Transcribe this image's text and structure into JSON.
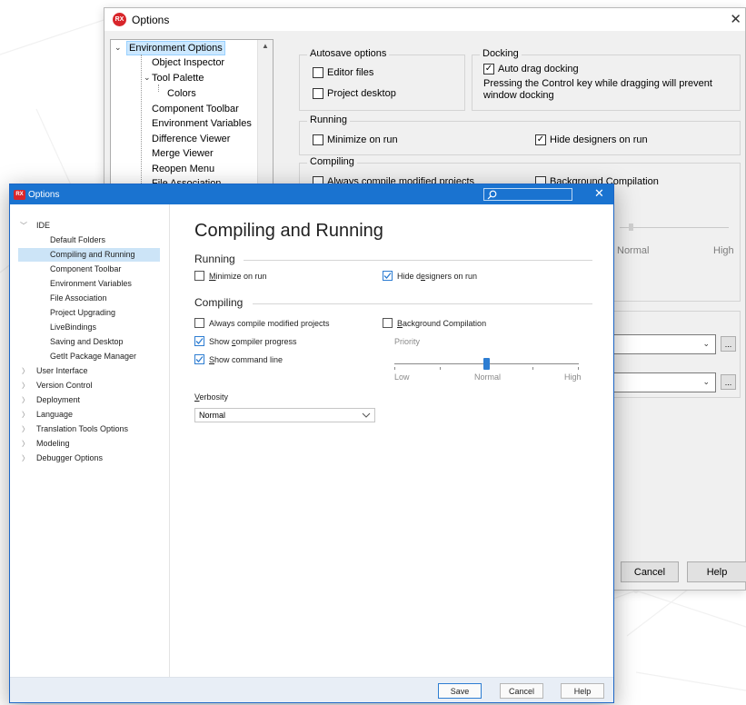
{
  "back_dialog": {
    "title": "Options",
    "close_icon": "close-icon",
    "tree": [
      {
        "label": "Environment Options",
        "expanded": true,
        "selected": true
      },
      {
        "label": "Object Inspector"
      },
      {
        "label": "Tool Palette",
        "expanded": true
      },
      {
        "label": "Colors"
      },
      {
        "label": "Component Toolbar"
      },
      {
        "label": "Environment Variables"
      },
      {
        "label": "Difference Viewer"
      },
      {
        "label": "Merge Viewer"
      },
      {
        "label": "Reopen Menu"
      },
      {
        "label": "File Association"
      }
    ],
    "autosave": {
      "title": "Autosave options",
      "editor_files": "Editor files",
      "project_desktop": "Project desktop"
    },
    "docking": {
      "title": "Docking",
      "auto_drag": "Auto drag docking",
      "note": "Pressing the Control key while dragging will prevent window docking"
    },
    "running": {
      "title": "Running",
      "minimize": "Minimize on run",
      "hide_designers": "Hide designers on run"
    },
    "compiling": {
      "title": "Compiling",
      "always_compile": "Always compile modified projects",
      "background": "Background Compilation",
      "normal": "Normal",
      "high": "High"
    },
    "buttons": {
      "cancel": "Cancel",
      "help": "Help"
    },
    "ellipsis": "..."
  },
  "front_dialog": {
    "title": "Options",
    "logo_text": "RX",
    "nav": {
      "ide": "IDE",
      "children": [
        "Default Folders",
        "Compiling and Running",
        "Component Toolbar",
        "Environment Variables",
        "File Association",
        "Project Upgrading",
        "LiveBindings",
        "Saving and Desktop",
        "GetIt Package Manager"
      ],
      "groups": [
        "User Interface",
        "Version Control",
        "Deployment",
        "Language",
        "Translation Tools Options",
        "Modeling",
        "Debugger Options"
      ]
    },
    "page_title": "Compiling and Running",
    "running": {
      "section": "Running",
      "minimize_ul": "M",
      "minimize_rest": "inimize on run",
      "hide_pre": "Hide d",
      "hide_ul": "e",
      "hide_post": "signers on run"
    },
    "compiling": {
      "section": "Compiling",
      "always": "Always compile modified projects",
      "show_progress_pre": "Show ",
      "show_progress_ul": "c",
      "show_progress_post": "ompiler progress",
      "show_cmd_ul": "S",
      "show_cmd_rest": "how command line",
      "verbosity_ul": "V",
      "verbosity_rest": "erbosity",
      "verbosity_value": "Normal",
      "background_ul": "B",
      "background_rest": "ackground Compilation",
      "priority": "Priority",
      "low": "Low",
      "normal": "Normal",
      "high": "High",
      "priority_level": 0.5
    },
    "buttons": {
      "save": "Save",
      "cancel": "Cancel",
      "help": "Help"
    }
  }
}
